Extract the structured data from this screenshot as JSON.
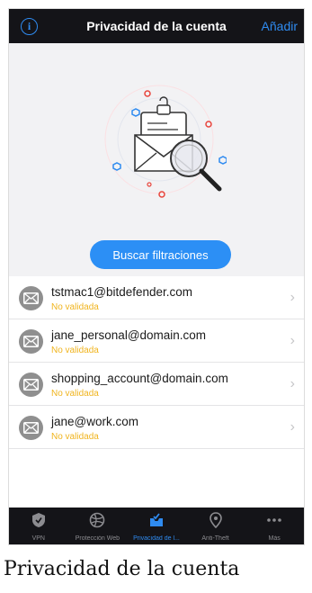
{
  "header": {
    "title": "Privacidad de la cuenta",
    "add_label": "Añadir",
    "info_icon": "info-icon"
  },
  "hero": {
    "illustration": "email-envelope-magnifier-illustration",
    "search_button": "Buscar filtraciones"
  },
  "accounts": [
    {
      "email": "tstmac1@bitdefender.com",
      "status": "No validada"
    },
    {
      "email": "jane_personal@domain.com",
      "status": "No validada"
    },
    {
      "email": "shopping_account@domain.com",
      "status": "No validada"
    },
    {
      "email": "jane@work.com",
      "status": "No validada"
    }
  ],
  "tabbar": {
    "tabs": [
      {
        "label": "VPN",
        "icon": "shield-icon",
        "active": false
      },
      {
        "label": "Protección Web",
        "icon": "globe-icon",
        "active": false
      },
      {
        "label": "Privacidad de l...",
        "icon": "privacy-inbox-icon",
        "active": true
      },
      {
        "label": "Anti-Theft",
        "icon": "location-pin-icon",
        "active": false
      },
      {
        "label": "Más",
        "icon": "more-icon",
        "active": false
      }
    ]
  },
  "caption": "Privacidad de la cuenta",
  "colors": {
    "accent": "#2f8bf0",
    "status_warning": "#f0b41e",
    "bar_background": "#141418"
  }
}
